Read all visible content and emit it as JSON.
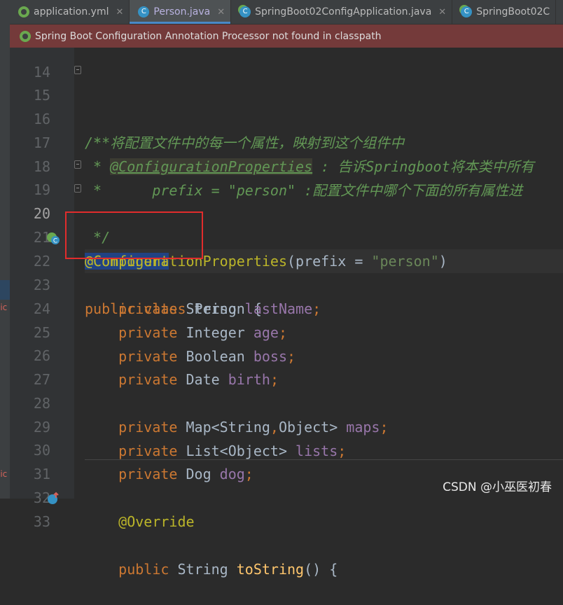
{
  "tabs": [
    {
      "label": "application.yml",
      "icon": "spring-leaf-icon",
      "active": false
    },
    {
      "label": "Person.java",
      "icon": "java-class-icon",
      "active": true
    },
    {
      "label": "SpringBoot02ConfigApplication.java",
      "icon": "spring-boot-app-icon",
      "active": false
    },
    {
      "label": "SpringBoot02C",
      "icon": "spring-boot-test-icon",
      "active": false
    }
  ],
  "banner": {
    "icon": "spring-leaf-icon",
    "text": "Spring Boot Configuration Annotation Processor not found in classpath"
  },
  "left_strip": {
    "fragment_1": "lic",
    "fragment_2": "lic"
  },
  "lines": [
    {
      "n": "14"
    },
    {
      "n": "15",
      "t1": "/**"
    },
    {
      "n": "16",
      "t1": " * 将配置文件中的每一个属性，映射到这个组件中"
    },
    {
      "n": "17",
      "t1": " * ",
      "t2": "@ConfigurationProperties",
      "t3": " : 告诉Springboot将本类中所有"
    },
    {
      "n": "18",
      "t1": " *      prefix = \"person\" :配置文件中哪个下面的所有属性进"
    },
    {
      "n": "19",
      "t1": " */"
    },
    {
      "n": "20",
      "t1": "@Component"
    },
    {
      "n": "21",
      "t1": "@ConfigurationProperties",
      "t2": "(prefix = ",
      "t3": "\"person\"",
      "t4": ")"
    },
    {
      "n": "22",
      "t1": "public class ",
      "t2": "Person {"
    },
    {
      "n": "23",
      "t1": "    private ",
      "t2": "String ",
      "t3": "lastName",
      "t4": ";"
    },
    {
      "n": "24",
      "t1": "    private ",
      "t2": "Integer ",
      "t3": "age",
      "t4": ";"
    },
    {
      "n": "25",
      "t1": "    private ",
      "t2": "Boolean ",
      "t3": "boss",
      "t4": ";"
    },
    {
      "n": "26",
      "t1": "    private ",
      "t2": "Date ",
      "t3": "birth",
      "t4": ";"
    },
    {
      "n": "27"
    },
    {
      "n": "28",
      "t1": "    private ",
      "t2": "Map<String",
      "t3": ",",
      "t4": "Object> ",
      "t5": "maps",
      "t6": ";"
    },
    {
      "n": "29",
      "t1": "    private ",
      "t2": "List<Object> ",
      "t3": "lists",
      "t4": ";"
    },
    {
      "n": "30",
      "t1": "    private ",
      "t2": "Dog ",
      "t3": "dog",
      "t4": ";"
    },
    {
      "n": "31"
    },
    {
      "n": "32",
      "t1": "    @Override"
    },
    {
      "n": "33",
      "t1": "    public ",
      "t2": "String ",
      "t3": "toString",
      "t4": "() {"
    }
  ],
  "watermark": "CSDN @小巫医初春",
  "colors": {
    "keyword": "#cc7832",
    "annotation": "#bbb529",
    "string": "#6a8759",
    "field": "#9876aa",
    "comment": "#629755",
    "banner_bg": "#743a3a",
    "highlight_box": "#e12c2c"
  }
}
